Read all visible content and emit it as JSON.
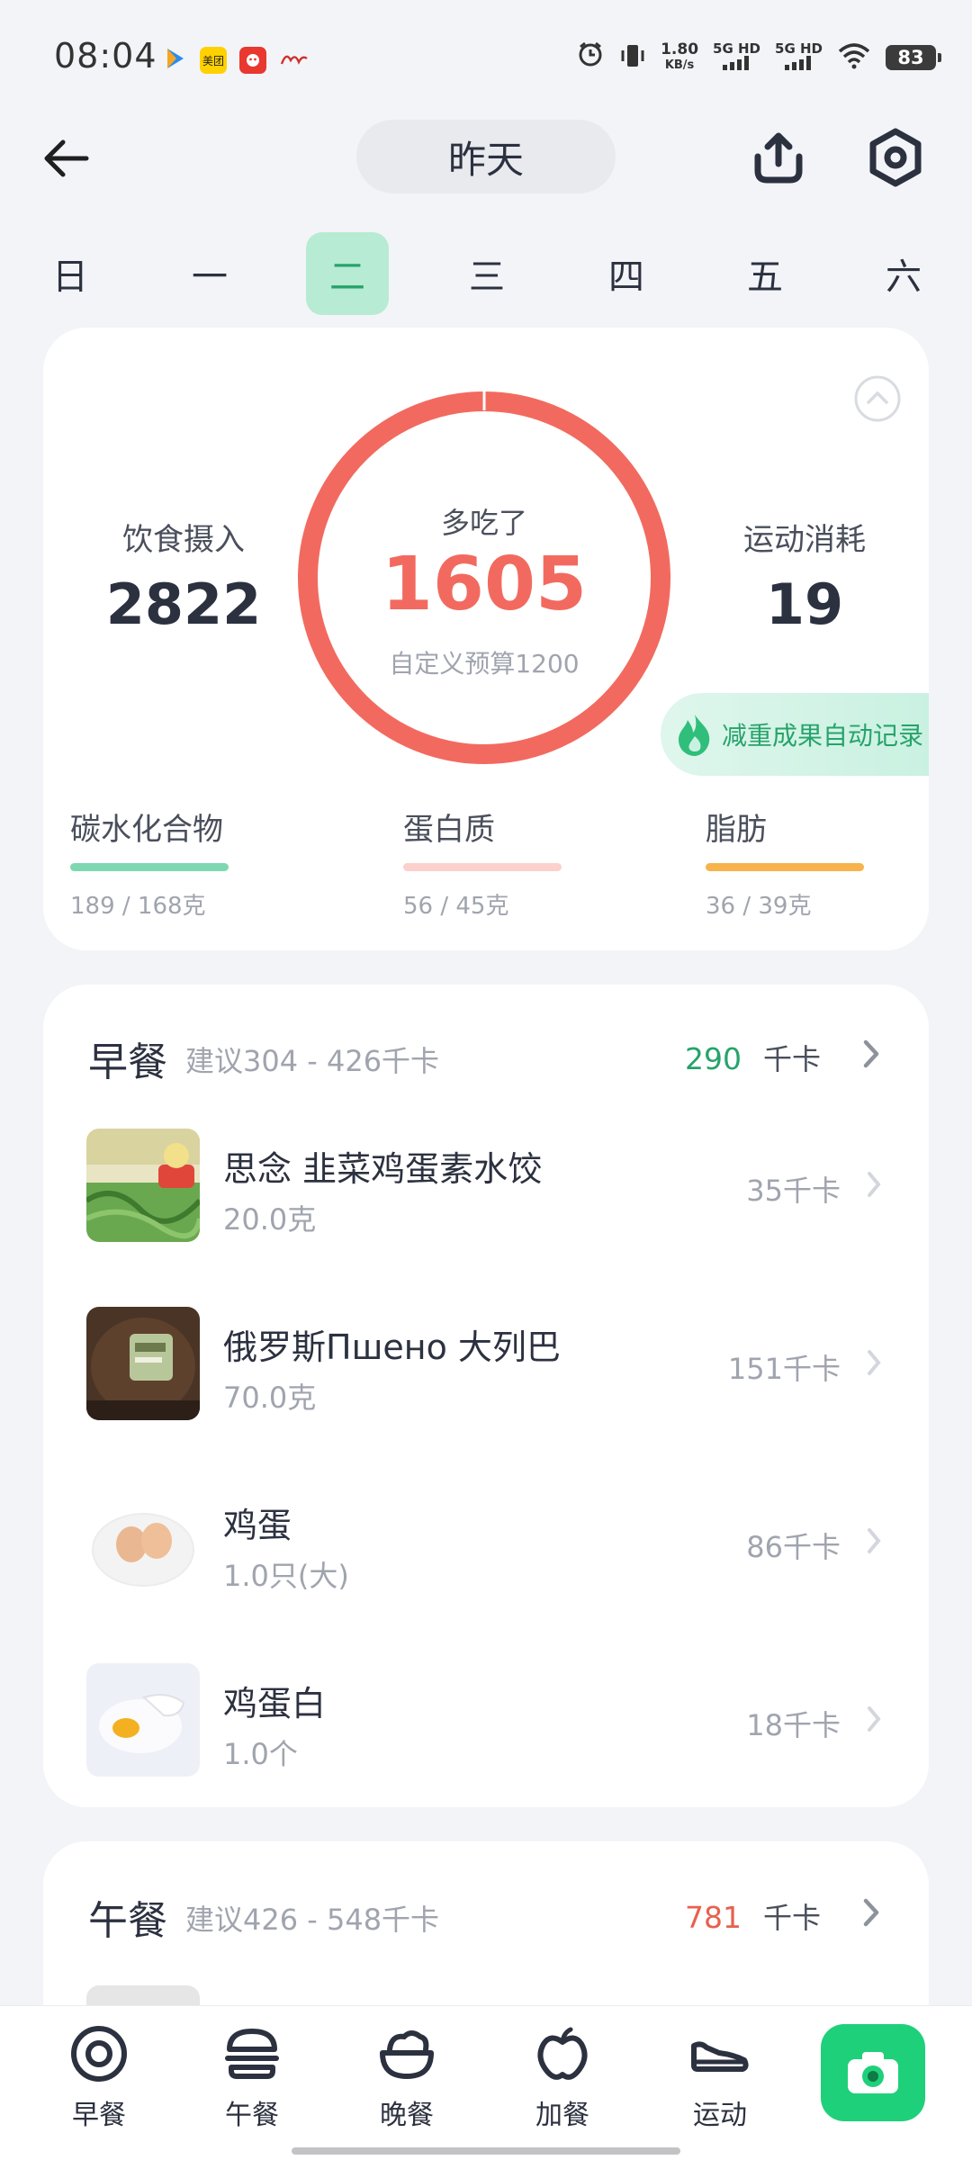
{
  "status_bar": {
    "time": "08:04",
    "net_speed_value": "1.80",
    "net_speed_unit": "KB/s",
    "sim1": "5G HD",
    "sim2": "5G HD",
    "battery": "83",
    "app_icons": [
      "video-app-icon",
      "meituan-icon",
      "red-app-icon",
      "news-app-icon"
    ],
    "meituan_label": "美团"
  },
  "header": {
    "date_label": "昨天",
    "icons": {
      "back": "arrow-left-icon",
      "share": "share-upload-icon",
      "settings": "hexagon-settings-icon"
    }
  },
  "weekdays": {
    "items": [
      "日",
      "一",
      "二",
      "三",
      "四",
      "五",
      "六"
    ],
    "selected_index": 2
  },
  "summary": {
    "intake_label": "饮食摄入",
    "intake_value": "2822",
    "burn_label": "运动消耗",
    "burn_value": "19",
    "ring_label": "多吃了",
    "ring_value": "1605",
    "ring_budget": "自定义预算1200",
    "badge_text": "减重成果自动记录",
    "macros": [
      {
        "label": "碳水化合物",
        "value": "189 / 168克",
        "color": "#7dd8b2"
      },
      {
        "label": "蛋白质",
        "value": "56 / 45克",
        "color": "#fcd0cc"
      },
      {
        "label": "脂肪",
        "value": "36 / 39克",
        "color": "#f7b34c"
      }
    ],
    "ring_color": "#f26a5f"
  },
  "breakfast": {
    "title": "早餐",
    "suggest": "建议304 - 426千卡",
    "kcal": "290",
    "kcal_unit": "千卡",
    "kcal_color": "#27a36b",
    "foods": [
      {
        "name": "思念 韭菜鸡蛋素水饺",
        "amount": "20.0克",
        "kcal": "35千卡"
      },
      {
        "name": "俄罗斯Пшено 大列巴",
        "amount": "70.0克",
        "kcal": "151千卡"
      },
      {
        "name": "鸡蛋",
        "amount": "1.0只(大)",
        "kcal": "86千卡"
      },
      {
        "name": "鸡蛋白",
        "amount": "1.0个",
        "kcal": "18千卡"
      }
    ]
  },
  "lunch": {
    "title": "午餐",
    "suggest": "建议426 - 548千卡",
    "kcal": "781",
    "kcal_unit": "千卡",
    "kcal_color": "#e8614f"
  },
  "bottom_nav": {
    "items": [
      {
        "label": "早餐",
        "icon": "plate-icon"
      },
      {
        "label": "午餐",
        "icon": "burger-icon"
      },
      {
        "label": "晚餐",
        "icon": "rice-bowl-icon"
      },
      {
        "label": "加餐",
        "icon": "apple-icon"
      },
      {
        "label": "运动",
        "icon": "sneaker-icon"
      }
    ],
    "camera_icon": "camera-icon",
    "accent": "#1fd07a"
  }
}
